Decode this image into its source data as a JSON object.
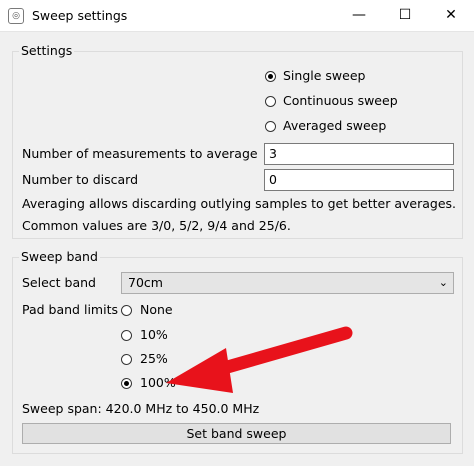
{
  "window": {
    "title": "Sweep settings",
    "minimize_glyph": "—",
    "maximize_glyph": "☐",
    "close_glyph": "✕"
  },
  "settings": {
    "group_title": "Settings",
    "modes": [
      {
        "label": "Single sweep",
        "checked": true
      },
      {
        "label": "Continuous sweep",
        "checked": false
      },
      {
        "label": "Averaged sweep",
        "checked": false
      }
    ],
    "avg_label": "Number of measurements to average",
    "avg_value": "3",
    "discard_label": "Number to discard",
    "discard_value": "0",
    "note_line1": "Averaging allows discarding outlying samples to get better averages.",
    "note_line2": "Common values are 3/0, 5/2, 9/4 and 25/6."
  },
  "sweep_band": {
    "group_title": "Sweep band",
    "select_label": "Select band",
    "selected_band": "70cm",
    "pad_label": "Pad band limits",
    "pad_options": [
      {
        "label": "None",
        "checked": false
      },
      {
        "label": "10%",
        "checked": false
      },
      {
        "label": "25%",
        "checked": false
      },
      {
        "label": "100%",
        "checked": true
      }
    ],
    "span_text": "Sweep span: 420.0 MHz to 450.0 MHz",
    "set_button": "Set band sweep"
  },
  "annotation": {
    "arrow_color": "#e8121b"
  }
}
